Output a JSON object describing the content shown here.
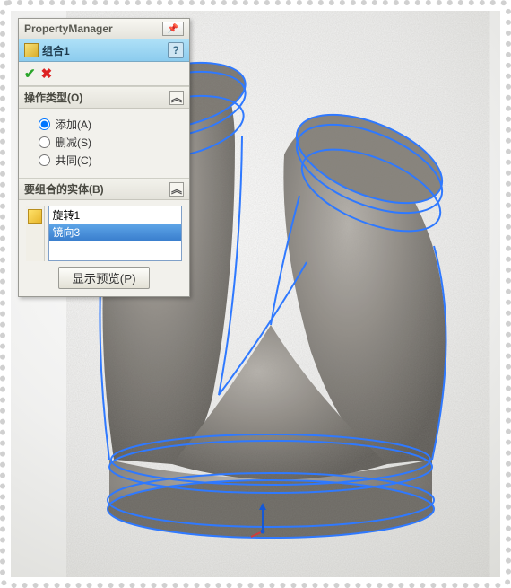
{
  "panel": {
    "title": "PropertyManager",
    "feature_name": "组合1",
    "help_label": "?",
    "ok_tooltip": "OK",
    "cancel_tooltip": "Cancel"
  },
  "operation": {
    "header": "操作类型(O)",
    "options": {
      "add": {
        "label": "添加(A)",
        "checked": true
      },
      "remove": {
        "label": "删减(S)",
        "checked": false
      },
      "common": {
        "label": "共同(C)",
        "checked": false
      }
    }
  },
  "bodies": {
    "header": "要组合的实体(B)",
    "items": [
      {
        "label": "旋转1",
        "selected": false
      },
      {
        "label": "镜向3",
        "selected": true
      }
    ],
    "preview_button": "显示预览(P)"
  },
  "icons": {
    "pin": "📌",
    "chevron": "︽"
  }
}
